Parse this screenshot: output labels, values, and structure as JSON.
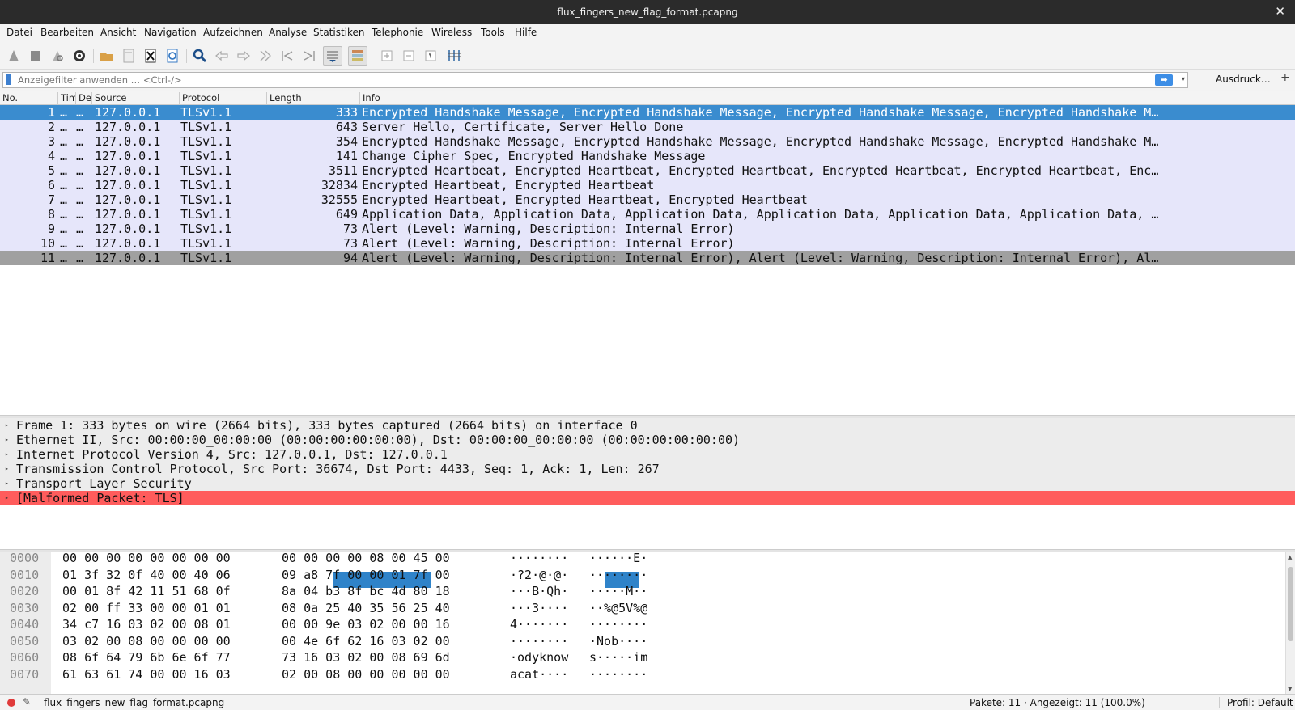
{
  "window": {
    "title": "flux_fingers_new_flag_format.pcapng",
    "close_glyph": "✕"
  },
  "menu": [
    "Datei",
    "Bearbeiten",
    "Ansicht",
    "Navigation",
    "Aufzeichnen",
    "Analyse",
    "Statistiken",
    "Telephonie",
    "Wireless",
    "Tools",
    "Hilfe"
  ],
  "toolbar_icons": [
    "shark-fin-start-icon",
    "stop-icon",
    "shark-fin-restart-icon",
    "gear-options-icon",
    "open-folder-icon",
    "save-file-icon",
    "close-file-icon",
    "reload-icon",
    "search-icon",
    "go-back-icon",
    "go-forward-icon",
    "go-to-packet-icon",
    "first-packet-icon",
    "last-packet-icon",
    "autoscroll-icon",
    "colorize-icon",
    "zoom-in-icon",
    "zoom-out-icon",
    "zoom-normal-icon",
    "resize-columns-icon"
  ],
  "filter": {
    "placeholder": "Anzeigefilter anwenden … <Ctrl-/>",
    "apply_glyph": "➡",
    "dropdown_glyph": "▾",
    "expression_label": "Ausdruck…",
    "add_glyph": "+"
  },
  "packet_list": {
    "columns": {
      "no": "No.",
      "time": "Time",
      "dst": "Destination",
      "src": "Source",
      "proto": "Protocol",
      "len": "Length",
      "info": "Info"
    },
    "rows": [
      {
        "no": "1",
        "time": "…",
        "dst": "…",
        "src": "127.0.0.1",
        "proto": "TLSv1.1",
        "len": "333",
        "info": "Encrypted Handshake Message, Encrypted Handshake Message, Encrypted Handshake Message, Encrypted Handshake M…",
        "state": "selected"
      },
      {
        "no": "2",
        "time": "…",
        "dst": "…",
        "src": "127.0.0.1",
        "proto": "TLSv1.1",
        "len": "643",
        "info": "Server Hello, Certificate, Server Hello Done",
        "state": "normal"
      },
      {
        "no": "3",
        "time": "…",
        "dst": "…",
        "src": "127.0.0.1",
        "proto": "TLSv1.1",
        "len": "354",
        "info": "Encrypted Handshake Message, Encrypted Handshake Message, Encrypted Handshake Message, Encrypted Handshake M…",
        "state": "normal"
      },
      {
        "no": "4",
        "time": "…",
        "dst": "…",
        "src": "127.0.0.1",
        "proto": "TLSv1.1",
        "len": "141",
        "info": "Change Cipher Spec, Encrypted Handshake Message",
        "state": "normal"
      },
      {
        "no": "5",
        "time": "…",
        "dst": "…",
        "src": "127.0.0.1",
        "proto": "TLSv1.1",
        "len": "3511",
        "info": "Encrypted Heartbeat, Encrypted Heartbeat, Encrypted Heartbeat, Encrypted Heartbeat, Encrypted Heartbeat, Enc…",
        "state": "normal"
      },
      {
        "no": "6",
        "time": "…",
        "dst": "…",
        "src": "127.0.0.1",
        "proto": "TLSv1.1",
        "len": "32834",
        "info": "Encrypted Heartbeat, Encrypted Heartbeat",
        "state": "normal"
      },
      {
        "no": "7",
        "time": "…",
        "dst": "…",
        "src": "127.0.0.1",
        "proto": "TLSv1.1",
        "len": "32555",
        "info": "Encrypted Heartbeat, Encrypted Heartbeat, Encrypted Heartbeat",
        "state": "normal"
      },
      {
        "no": "8",
        "time": "…",
        "dst": "…",
        "src": "127.0.0.1",
        "proto": "TLSv1.1",
        "len": "649",
        "info": "Application Data, Application Data, Application Data, Application Data, Application Data, Application Data, …",
        "state": "normal"
      },
      {
        "no": "9",
        "time": "…",
        "dst": "…",
        "src": "127.0.0.1",
        "proto": "TLSv1.1",
        "len": "73",
        "info": "Alert (Level: Warning, Description: Internal Error)",
        "state": "normal"
      },
      {
        "no": "10",
        "time": "…",
        "dst": "…",
        "src": "127.0.0.1",
        "proto": "TLSv1.1",
        "len": "73",
        "info": "Alert (Level: Warning, Description: Internal Error)",
        "state": "normal"
      },
      {
        "no": "11",
        "time": "…",
        "dst": "…",
        "src": "127.0.0.1",
        "proto": "TLSv1.1",
        "len": "94",
        "info": "Alert (Level: Warning, Description: Internal Error), Alert (Level: Warning, Description: Internal Error), Al…",
        "state": "dark"
      }
    ]
  },
  "details": [
    {
      "text": "Frame 1: 333 bytes on wire (2664 bits), 333 bytes captured (2664 bits) on interface 0",
      "malformed": false
    },
    {
      "text": "Ethernet II, Src: 00:00:00_00:00:00 (00:00:00:00:00:00), Dst: 00:00:00_00:00:00 (00:00:00:00:00:00)",
      "malformed": false
    },
    {
      "text": "Internet Protocol Version 4, Src: 127.0.0.1, Dst: 127.0.0.1",
      "malformed": false
    },
    {
      "text": "Transmission Control Protocol, Src Port: 36674, Dst Port: 4433, Seq: 1, Ack: 1, Len: 267",
      "malformed": false
    },
    {
      "text": "Transport Layer Security",
      "malformed": false
    },
    {
      "text": "[Malformed Packet: TLS]",
      "malformed": true
    }
  ],
  "details_arrow": "▸",
  "bytes": [
    {
      "offset": "0000",
      "hex1": "00 00 00 00 00 00 00 00",
      "hex2": "00 00 00 00 08 00 45 00",
      "asc1": "········",
      "asc2": "······E·"
    },
    {
      "offset": "0010",
      "hex1": "01 3f 32 0f 40 00 40 06",
      "hex2": "09 a8 7f 00 00 01 7f 00",
      "asc1": "·?2·@·@·",
      "asc2": "········"
    },
    {
      "offset": "0020",
      "hex1": "00 01 8f 42 11 51 68 0f",
      "hex2": "8a 04 b3 8f bc 4d 80 18",
      "asc1": "···B·Qh·",
      "asc2": "·····M··"
    },
    {
      "offset": "0030",
      "hex1": "02 00 ff 33 00 00 01 01",
      "hex2": "08 0a 25 40 35 56 25 40",
      "asc1": "···3····",
      "asc2": "··%@5V%@"
    },
    {
      "offset": "0040",
      "hex1": "34 c7 16 03 02 00 08 01",
      "hex2": "00 00 9e 03 02 00 00 16",
      "asc1": "4·······",
      "asc2": "········"
    },
    {
      "offset": "0050",
      "hex1": "03 02 00 08 00 00 00 00",
      "hex2": "00 4e 6f 62 16 03 02 00",
      "asc1": "········",
      "asc2": "·Nob····"
    },
    {
      "offset": "0060",
      "hex1": "08 6f 64 79 6b 6e 6f 77",
      "hex2": "73 16 03 02 00 08 69 6d",
      "asc1": "·odyknow",
      "asc2": "s·····im"
    },
    {
      "offset": "0070",
      "hex1": "61 63 61 74 00 00 16 03",
      "hex2": "02 00 08 00 00 00 00 00",
      "asc1": "acat····",
      "asc2": "········"
    }
  ],
  "scroll": {
    "up": "▲",
    "down": "▼"
  },
  "status": {
    "file": "flux_fingers_new_flag_format.pcapng",
    "packets": "Pakete: 11 · Angezeigt: 11 (100.0%)",
    "profile": "Profil: Default",
    "edit_glyph": "✎"
  },
  "colors": {
    "selected_row": "#3a8ccf",
    "row_bg": "#e6e6fa",
    "malformed": "#ff5c5c",
    "dark_row": "#a0a0a0"
  }
}
